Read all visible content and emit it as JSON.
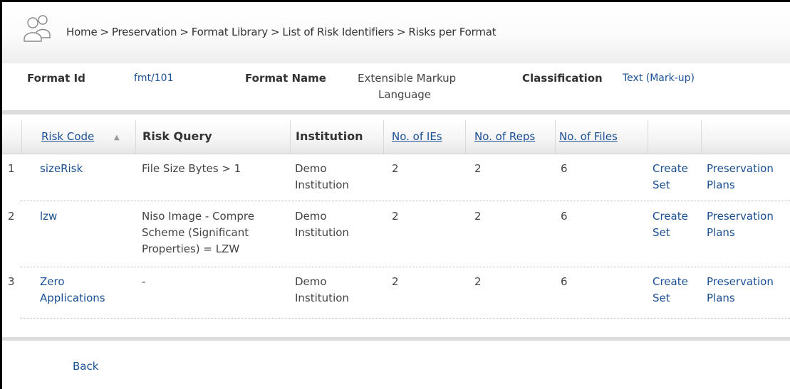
{
  "breadcrumb": [
    "Home",
    "Preservation",
    "Format Library",
    "List of Risk Identifiers",
    "Risks per Format"
  ],
  "breadcrumb_separator": ">",
  "format": {
    "id_label": "Format Id",
    "id_value": "fmt/101",
    "name_label": "Format Name",
    "name_value_line1": "Extensible Markup",
    "name_value_line2": "Language",
    "classification_label": "Classification",
    "classification_value": "Text (Mark-up)"
  },
  "table": {
    "headers": {
      "risk_code": "Risk Code",
      "risk_query": "Risk Query",
      "institution": "Institution",
      "num_ies": "No. of IEs",
      "num_reps": "No. of Reps",
      "num_files": "No. of Files"
    },
    "sort_icon": "▲",
    "rows": [
      {
        "index": "1",
        "risk_code": [
          "sizeRisk"
        ],
        "risk_query": [
          "File Size Bytes > 1"
        ],
        "institution": [
          "Demo",
          "Institution"
        ],
        "ies": "2",
        "reps": "2",
        "files": "6",
        "create_set": [
          "Create",
          "Set"
        ],
        "plans": [
          "Preservation",
          "Plans"
        ]
      },
      {
        "index": "2",
        "risk_code": [
          "lzw"
        ],
        "risk_query": [
          "Niso Image - Compre",
          "Scheme (Significant",
          "Properties) = LZW"
        ],
        "institution": [
          "Demo",
          "Institution"
        ],
        "ies": "2",
        "reps": "2",
        "files": "6",
        "create_set": [
          "Create",
          "Set"
        ],
        "plans": [
          "Preservation",
          "Plans"
        ]
      },
      {
        "index": "3",
        "risk_code": [
          "Zero",
          "Applications"
        ],
        "risk_query": [
          "-"
        ],
        "institution": [
          "Demo",
          "Institution"
        ],
        "ies": "2",
        "reps": "2",
        "files": "6",
        "create_set": [
          "Create",
          "Set"
        ],
        "plans": [
          "Preservation",
          "Plans"
        ]
      }
    ]
  },
  "back_label": "Back",
  "colors": {
    "link": "#1a4f94",
    "text": "#333333",
    "divider": "#dcdcdc"
  }
}
